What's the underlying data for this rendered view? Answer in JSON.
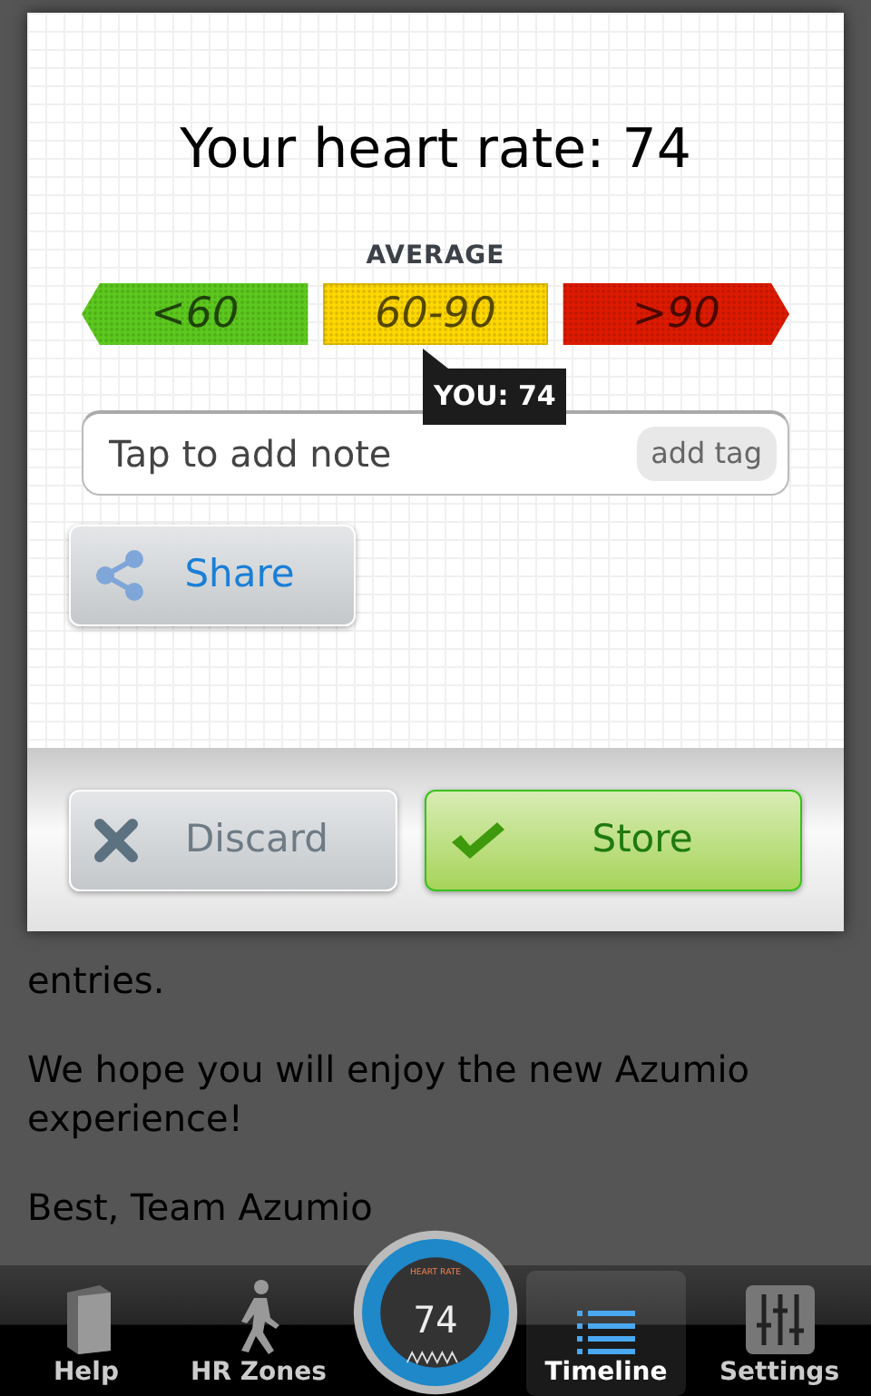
{
  "background_text": [
    {
      "text": "entries."
    },
    {
      "text": "We hope you will enjoy the new Azumio experience!"
    },
    {
      "text": "Best, Team Azumio"
    }
  ],
  "dialog": {
    "title": "Your heart rate: 74",
    "range_heading": "AVERAGE",
    "ranges": [
      {
        "label": "<60",
        "color": "#5cc81e",
        "selected": false
      },
      {
        "label": "60-90",
        "color": "#ffd700",
        "selected": true
      },
      {
        "label": ">90",
        "color": "#dd1a00",
        "selected": false
      }
    ],
    "marker": "YOU: 74",
    "note": {
      "placeholder": "Tap to add note",
      "tag_button": "add tag"
    },
    "share_button": "Share",
    "discard_button": "Discard",
    "store_button": "Store"
  },
  "tab_bar": {
    "tabs": [
      {
        "label": "Help",
        "kind": "book",
        "selected": false
      },
      {
        "label": "HR Zones",
        "kind": "walker",
        "selected": false
      },
      {
        "label": "Timeline",
        "kind": "list",
        "selected": true
      },
      {
        "label": "Settings",
        "kind": "sliders",
        "selected": false
      }
    ],
    "gauge": {
      "label": "HEART RATE",
      "reading": "74"
    }
  }
}
